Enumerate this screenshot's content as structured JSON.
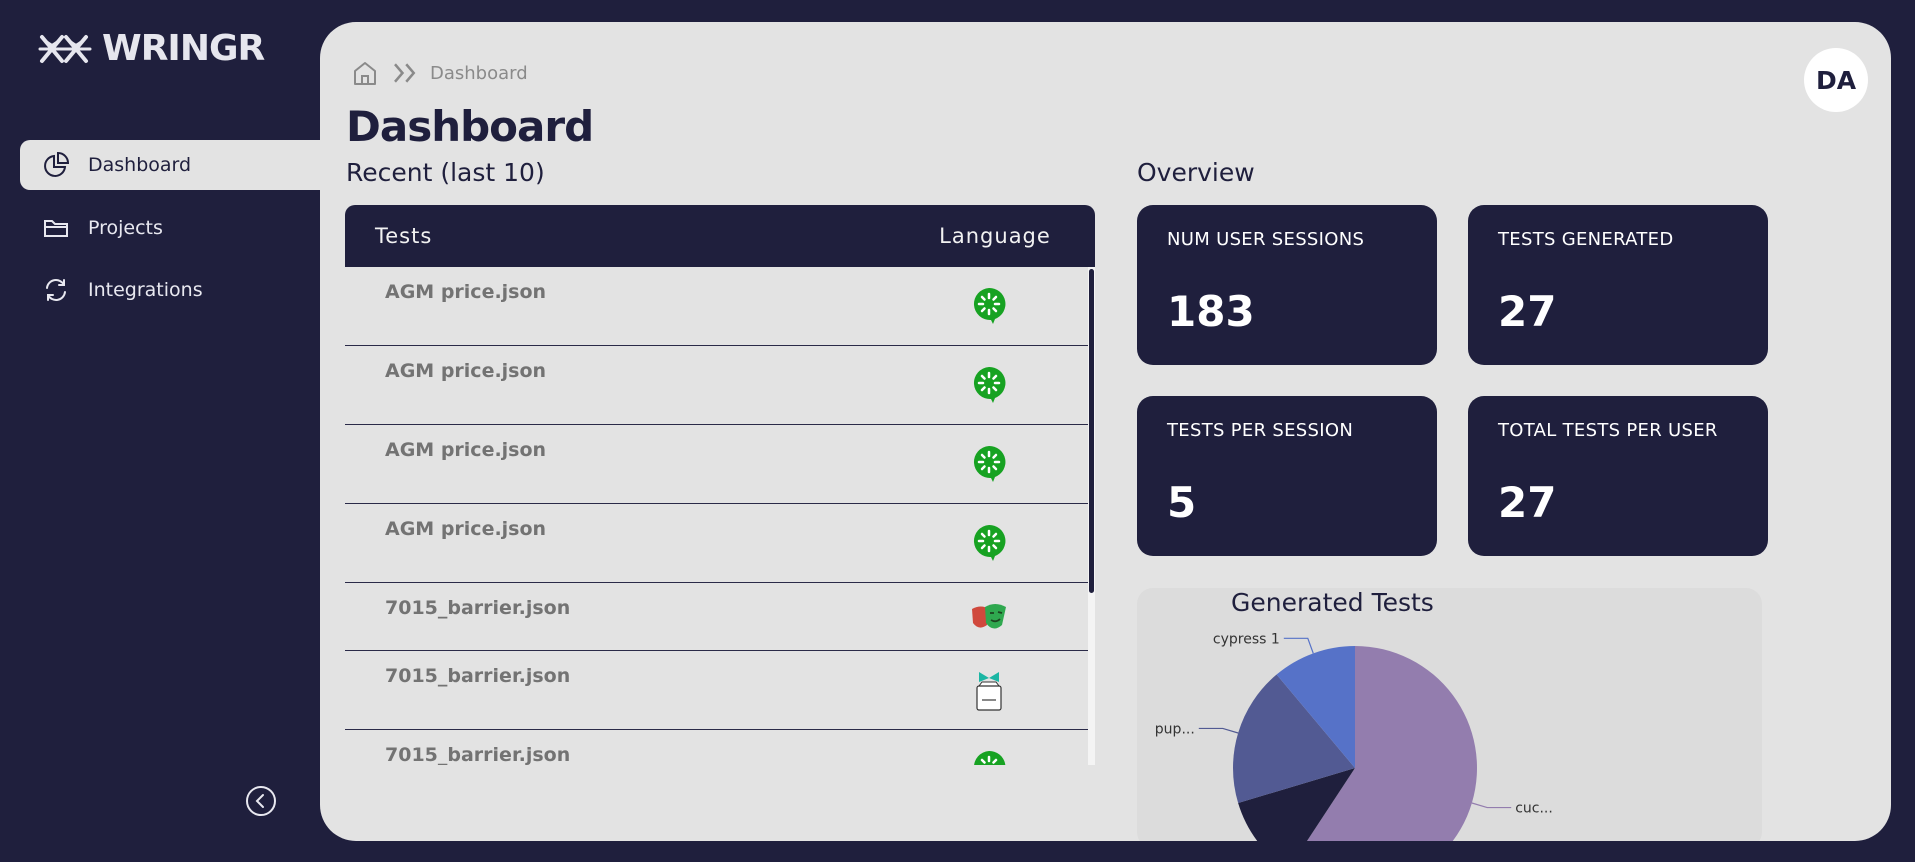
{
  "app": {
    "name": "WRINGR"
  },
  "sidebar": {
    "items": [
      {
        "label": "Dashboard",
        "icon": "pie-chart-icon",
        "active": true
      },
      {
        "label": "Projects",
        "icon": "folder-icon",
        "active": false
      },
      {
        "label": "Integrations",
        "icon": "refresh-icon",
        "active": false
      }
    ]
  },
  "header": {
    "breadcrumb": "Dashboard",
    "title": "Dashboard",
    "avatar": "DA"
  },
  "recent": {
    "title": "Recent (last 10)",
    "columns": [
      "Tests",
      "Language"
    ],
    "rows": [
      {
        "name": "AGM price.json",
        "language_icon": "cucumber-icon"
      },
      {
        "name": "AGM price.json",
        "language_icon": "cucumber-icon"
      },
      {
        "name": "AGM price.json",
        "language_icon": "cucumber-icon"
      },
      {
        "name": "AGM price.json",
        "language_icon": "cucumber-icon"
      },
      {
        "name": "7015_barrier.json",
        "language_icon": "playwright-icon"
      },
      {
        "name": "7015_barrier.json",
        "language_icon": "puppeteer-icon"
      },
      {
        "name": "7015_barrier.json",
        "language_icon": "cucumber-icon"
      }
    ]
  },
  "overview": {
    "title": "Overview",
    "cards": [
      {
        "label": "NUM USER SESSIONS",
        "value": "183"
      },
      {
        "label": "TESTS GENERATED",
        "value": "27"
      },
      {
        "label": "TESTS PER SESSION",
        "value": "5"
      },
      {
        "label": "TOTAL TESTS PER USER",
        "value": "27"
      }
    ]
  },
  "chart_data": {
    "type": "pie",
    "title": "Generated Tests",
    "slices": [
      {
        "label": "cuc...",
        "value": 16,
        "color": "#937dae"
      },
      {
        "label": "",
        "value": 3,
        "color": "#1f1f3d"
      },
      {
        "label": "pup...",
        "value": 5,
        "color": "#525a93"
      },
      {
        "label": "cypress 1",
        "value": 3,
        "color": "#5672c8"
      }
    ]
  },
  "colors": {
    "background": "#1f1f3d",
    "panel": "#e3e3e3",
    "accent_green": "#17a222"
  }
}
